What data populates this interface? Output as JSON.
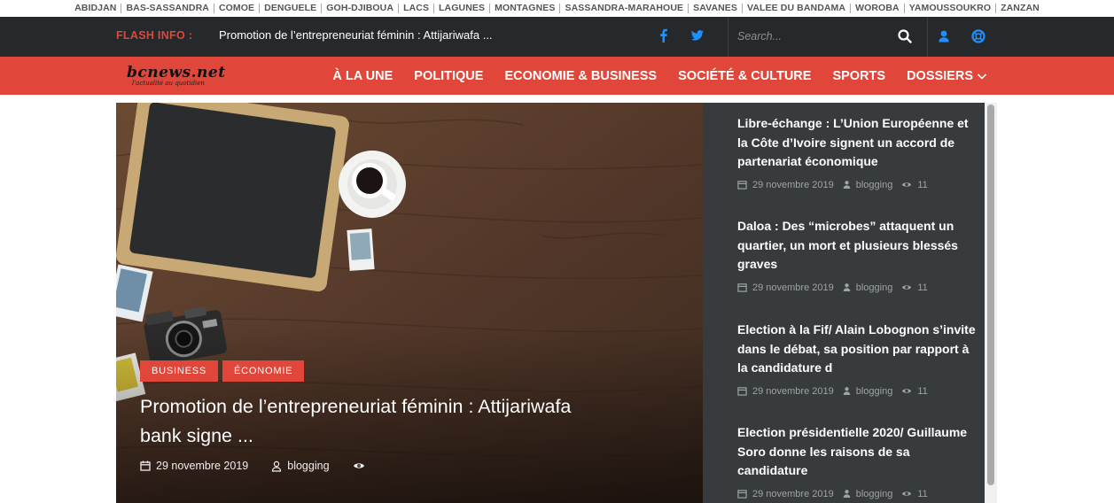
{
  "regions": [
    "ABIDJAN",
    "BAS-SASSANDRA",
    "COMOE",
    "DENGUELE",
    "GOH-DJIBOUA",
    "LACS",
    "LAGUNES",
    "MONTAGNES",
    "SASSANDRA-MARAHOUE",
    "SAVANES",
    "VALEE DU BANDAMA",
    "WOROBA",
    "YAMOUSSOUKRO",
    "ZANZAN"
  ],
  "topbar": {
    "flash_label": "FLASH INFO :",
    "flash_text": "Promotion de l’entrepreneuriat féminin : Attijariwafa ...",
    "search_placeholder": "Search..."
  },
  "logo": {
    "name": "bcnews.net",
    "tagline": "l'actualité au quotidien"
  },
  "menu": [
    "À LA UNE",
    "POLITIQUE",
    "ECONOMIE & BUSINESS",
    "SOCIÉTÉ & CULTURE",
    "SPORTS",
    "DOSSIERS"
  ],
  "hero": {
    "tags": [
      "BUSINESS",
      "ÉCONOMIE"
    ],
    "title": "Promotion de l’entrepreneuriat féminin : Attijariwafa bank signe ...",
    "date": "29 novembre 2019",
    "author": "blogging"
  },
  "side_posts": [
    {
      "title": "Libre-échange : L’Union Européenne et la Côte d’Ivoire signent un accord de partenariat économique",
      "date": "29 novembre 2019",
      "author": "blogging",
      "views": "11"
    },
    {
      "title": "Daloa : Des “microbes” attaquent un quartier, un mort et plusieurs blessés graves",
      "date": "29 novembre 2019",
      "author": "blogging",
      "views": "11"
    },
    {
      "title": "Election à la Fif/ Alain Lobognon s’invite dans le débat, sa position par rapport à la candidature d",
      "date": "29 novembre 2019",
      "author": "blogging",
      "views": "11"
    },
    {
      "title": "Election présidentielle 2020/ Guillaume Soro donne les raisons de sa candidature",
      "date": "29 novembre 2019",
      "author": "blogging",
      "views": "11"
    }
  ],
  "colors": {
    "accent": "#e0463a",
    "dark": "#26292b",
    "side": "#383b3d",
    "social": "#1e90ff"
  },
  "icons": [
    "facebook-icon",
    "twitter-icon",
    "search-icon",
    "user-icon",
    "help-icon",
    "calendar-icon",
    "user-outline-icon",
    "eye-icon",
    "chevron-down-icon"
  ]
}
